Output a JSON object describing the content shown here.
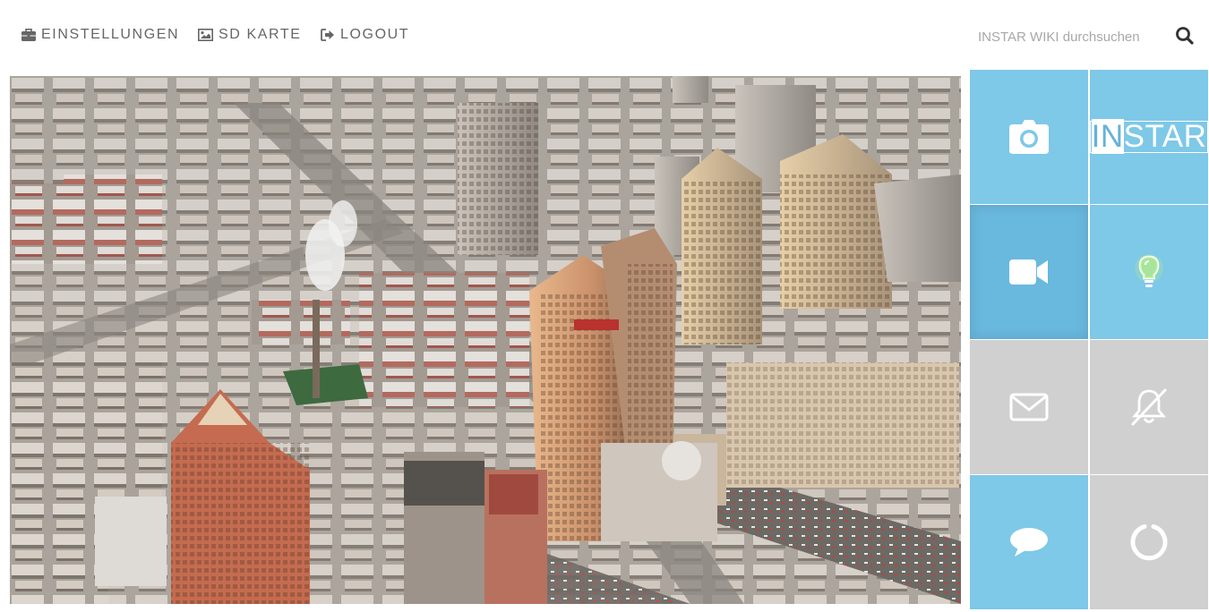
{
  "nav": {
    "items": [
      {
        "label": "EINSTELLUNGEN",
        "icon": "briefcase-icon"
      },
      {
        "label": "SD KARTE",
        "icon": "image-icon"
      },
      {
        "label": "LOGOUT",
        "icon": "sign-out-icon"
      }
    ],
    "search": {
      "placeholder": "INSTAR WIKI durchsuchen",
      "value": "",
      "icon": "search-icon"
    }
  },
  "video": {
    "content": "aerial city view live stream"
  },
  "tiles": [
    {
      "name": "snapshot",
      "icon": "camera-icon",
      "color": "#7ec8e8"
    },
    {
      "name": "brand",
      "text": "INSTAR",
      "text_highlight": "IN",
      "text_rest": "STAR",
      "color": "#7ec8e8"
    },
    {
      "name": "record",
      "icon": "video-camera-icon",
      "color": "#69b8de",
      "state": "active"
    },
    {
      "name": "ir-led",
      "icon": "lightbulb-icon",
      "color": "#7ec8e8",
      "icon_color": "#b8f27a"
    },
    {
      "name": "email-alarm",
      "icon": "envelope-icon",
      "color": "#d0d0d0"
    },
    {
      "name": "alarm-disabled",
      "icon": "bell-slash-icon",
      "color": "#d0d0d0"
    },
    {
      "name": "message",
      "icon": "chat-bubble-icon",
      "color": "#7ec8e8"
    },
    {
      "name": "loading",
      "icon": "circle-notch-icon",
      "color": "#d0d0d0"
    }
  ],
  "colors": {
    "tile_blue": "#7ec8e8",
    "tile_grey": "#d0d0d0",
    "nav_text": "#666666"
  }
}
